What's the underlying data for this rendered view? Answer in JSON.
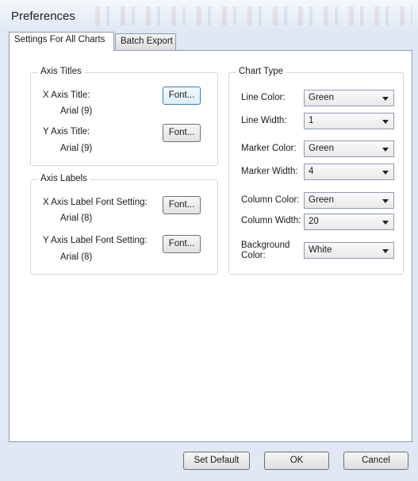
{
  "window": {
    "title": "Preferences"
  },
  "tabs": [
    {
      "label": "Settings For All Charts",
      "active": true
    },
    {
      "label": "Batch Export",
      "active": false
    }
  ],
  "axis_titles": {
    "group_title": "Axis Titles",
    "x_label": "X Axis Title:",
    "x_font": "Arial (9)",
    "y_label": "Y Axis Title:",
    "y_font": "Arial (9)",
    "font_button": "Font..."
  },
  "axis_labels": {
    "group_title": "Axis Labels",
    "x_label": "X Axis Label Font Setting:",
    "x_font": "Arial (8)",
    "y_label": "Y Axis Label Font Setting:",
    "y_font": "Arial (8)",
    "font_button": "Font..."
  },
  "chart_type": {
    "group_title": "Chart Type",
    "line_color_label": "Line Color:",
    "line_color_value": "Green",
    "line_width_label": "Line Width:",
    "line_width_value": "1",
    "marker_color_label": "Marker Color:",
    "marker_color_value": "Green",
    "marker_width_label": "Marker Width:",
    "marker_width_value": "4",
    "column_color_label": "Column Color:",
    "column_color_value": "Green",
    "column_width_label": "Column Width:",
    "column_width_value": "20",
    "background_color_label_1": "Background",
    "background_color_label_2": "Color:",
    "background_color_value": "White"
  },
  "footer": {
    "set_default": "Set Default",
    "ok": "OK",
    "cancel": "Cancel"
  },
  "icons": {
    "dropdown": "chevron-down-icon"
  }
}
